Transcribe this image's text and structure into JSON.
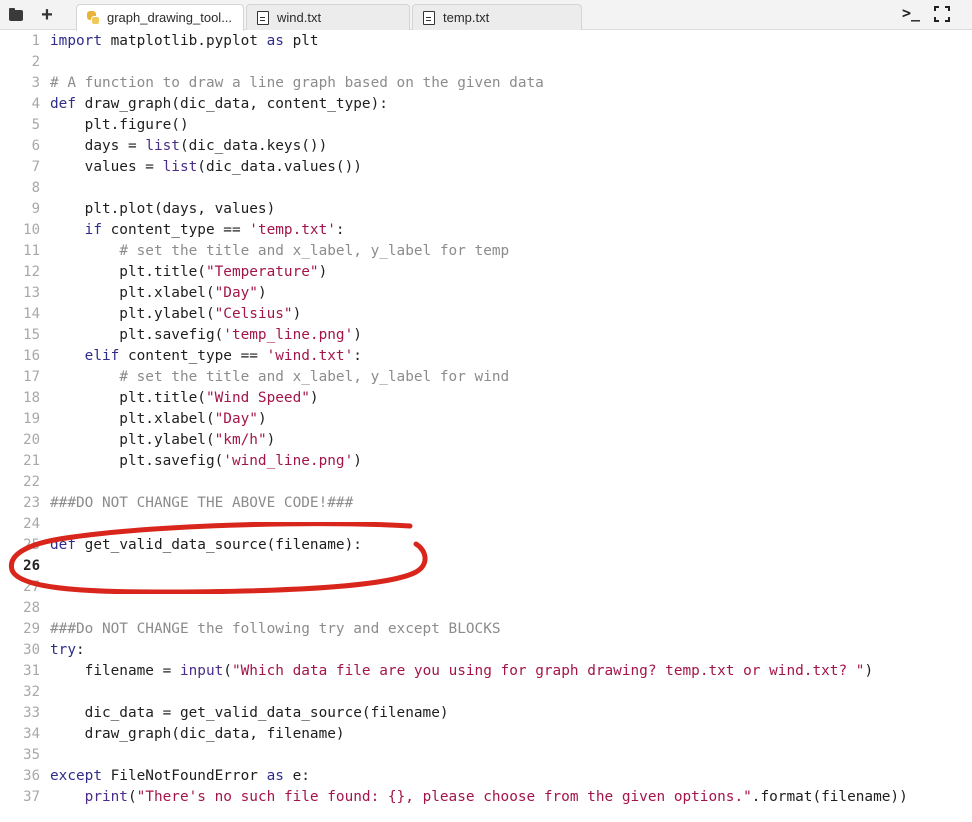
{
  "tabs": [
    {
      "label": "graph_drawing_tool...",
      "icon": "python-file-icon",
      "active": true
    },
    {
      "label": "wind.txt",
      "icon": "text-file-icon",
      "active": false
    },
    {
      "label": "temp.txt",
      "icon": "text-file-icon",
      "active": false
    }
  ],
  "toolbar": {
    "terminal_icon": "terminal-icon",
    "fullscreen_icon": "fullscreen-icon"
  },
  "editor": {
    "current_line": 26,
    "annotation_color": "#d9261c",
    "lines": [
      {
        "n": "1",
        "tokens": [
          [
            "kw",
            "import"
          ],
          [
            "t",
            " matplotlib.pyplot "
          ],
          [
            "kw",
            "as"
          ],
          [
            "t",
            " plt"
          ]
        ]
      },
      {
        "n": "2",
        "tokens": []
      },
      {
        "n": "3",
        "tokens": [
          [
            "cmt",
            "# A function to draw a line graph based on the given data"
          ]
        ]
      },
      {
        "n": "4",
        "tokens": [
          [
            "kw",
            "def"
          ],
          [
            "t",
            " draw_graph(dic_data, content_type):"
          ]
        ]
      },
      {
        "n": "5",
        "tokens": [
          [
            "t",
            "    plt.figure()"
          ]
        ]
      },
      {
        "n": "6",
        "tokens": [
          [
            "t",
            "    days = "
          ],
          [
            "fn",
            "list"
          ],
          [
            "t",
            "(dic_data.keys())"
          ]
        ]
      },
      {
        "n": "7",
        "tokens": [
          [
            "t",
            "    values = "
          ],
          [
            "fn",
            "list"
          ],
          [
            "t",
            "(dic_data.values())"
          ]
        ]
      },
      {
        "n": "8",
        "tokens": []
      },
      {
        "n": "9",
        "tokens": [
          [
            "t",
            "    plt.plot(days, values)"
          ]
        ]
      },
      {
        "n": "10",
        "tokens": [
          [
            "t",
            "    "
          ],
          [
            "kw",
            "if"
          ],
          [
            "t",
            " content_type == "
          ],
          [
            "str",
            "'temp.txt'"
          ],
          [
            "t",
            ":"
          ]
        ]
      },
      {
        "n": "11",
        "tokens": [
          [
            "t",
            "        "
          ],
          [
            "cmt",
            "# set the title and x_label, y_label for temp"
          ]
        ]
      },
      {
        "n": "12",
        "tokens": [
          [
            "t",
            "        plt.title("
          ],
          [
            "str",
            "\"Temperature\""
          ],
          [
            "t",
            ")"
          ]
        ]
      },
      {
        "n": "13",
        "tokens": [
          [
            "t",
            "        plt.xlabel("
          ],
          [
            "str",
            "\"Day\""
          ],
          [
            "t",
            ")"
          ]
        ]
      },
      {
        "n": "14",
        "tokens": [
          [
            "t",
            "        plt.ylabel("
          ],
          [
            "str",
            "\"Celsius\""
          ],
          [
            "t",
            ")"
          ]
        ]
      },
      {
        "n": "15",
        "tokens": [
          [
            "t",
            "        plt.savefig("
          ],
          [
            "str",
            "'temp_line.png'"
          ],
          [
            "t",
            ")"
          ]
        ]
      },
      {
        "n": "16",
        "tokens": [
          [
            "t",
            "    "
          ],
          [
            "kw",
            "elif"
          ],
          [
            "t",
            " content_type == "
          ],
          [
            "str",
            "'wind.txt'"
          ],
          [
            "t",
            ":"
          ]
        ]
      },
      {
        "n": "17",
        "tokens": [
          [
            "t",
            "        "
          ],
          [
            "cmt",
            "# set the title and x_label, y_label for wind"
          ]
        ]
      },
      {
        "n": "18",
        "tokens": [
          [
            "t",
            "        plt.title("
          ],
          [
            "str",
            "\"Wind Speed\""
          ],
          [
            "t",
            ")"
          ]
        ]
      },
      {
        "n": "19",
        "tokens": [
          [
            "t",
            "        plt.xlabel("
          ],
          [
            "str",
            "\"Day\""
          ],
          [
            "t",
            ")"
          ]
        ]
      },
      {
        "n": "20",
        "tokens": [
          [
            "t",
            "        plt.ylabel("
          ],
          [
            "str",
            "\"km/h\""
          ],
          [
            "t",
            ")"
          ]
        ]
      },
      {
        "n": "21",
        "tokens": [
          [
            "t",
            "        plt.savefig("
          ],
          [
            "str",
            "'wind_line.png'"
          ],
          [
            "t",
            ")"
          ]
        ]
      },
      {
        "n": "22",
        "tokens": []
      },
      {
        "n": "23",
        "tokens": [
          [
            "cmt",
            "###DO NOT CHANGE THE ABOVE CODE!###"
          ]
        ]
      },
      {
        "n": "24",
        "tokens": []
      },
      {
        "n": "25",
        "tokens": [
          [
            "kw",
            "def"
          ],
          [
            "t",
            " get_valid_data_source(filename):"
          ]
        ]
      },
      {
        "n": "26",
        "tokens": []
      },
      {
        "n": "27",
        "tokens": []
      },
      {
        "n": "28",
        "tokens": []
      },
      {
        "n": "29",
        "tokens": [
          [
            "cmt",
            "###Do NOT CHANGE the following try and except BLOCKS"
          ]
        ]
      },
      {
        "n": "30",
        "tokens": [
          [
            "kw",
            "try"
          ],
          [
            "t",
            ":"
          ]
        ]
      },
      {
        "n": "31",
        "tokens": [
          [
            "t",
            "    filename = "
          ],
          [
            "fn",
            "input"
          ],
          [
            "t",
            "("
          ],
          [
            "str",
            "\"Which data file are you using for graph drawing? temp.txt or wind.txt? \""
          ],
          [
            "t",
            ")"
          ]
        ]
      },
      {
        "n": "32",
        "tokens": []
      },
      {
        "n": "33",
        "tokens": [
          [
            "t",
            "    dic_data = get_valid_data_source(filename)"
          ]
        ]
      },
      {
        "n": "34",
        "tokens": [
          [
            "t",
            "    draw_graph(dic_data, filename)"
          ]
        ]
      },
      {
        "n": "35",
        "tokens": []
      },
      {
        "n": "36",
        "tokens": [
          [
            "kw",
            "except"
          ],
          [
            "t",
            " FileNotFoundError "
          ],
          [
            "kw",
            "as"
          ],
          [
            "t",
            " e:"
          ]
        ]
      },
      {
        "n": "37",
        "tokens": [
          [
            "t",
            "    "
          ],
          [
            "fn",
            "print"
          ],
          [
            "t",
            "("
          ],
          [
            "str",
            "\"There's no such file found: {}, please choose from the given options.\""
          ],
          [
            "t",
            ".format(filename))"
          ]
        ]
      }
    ]
  }
}
